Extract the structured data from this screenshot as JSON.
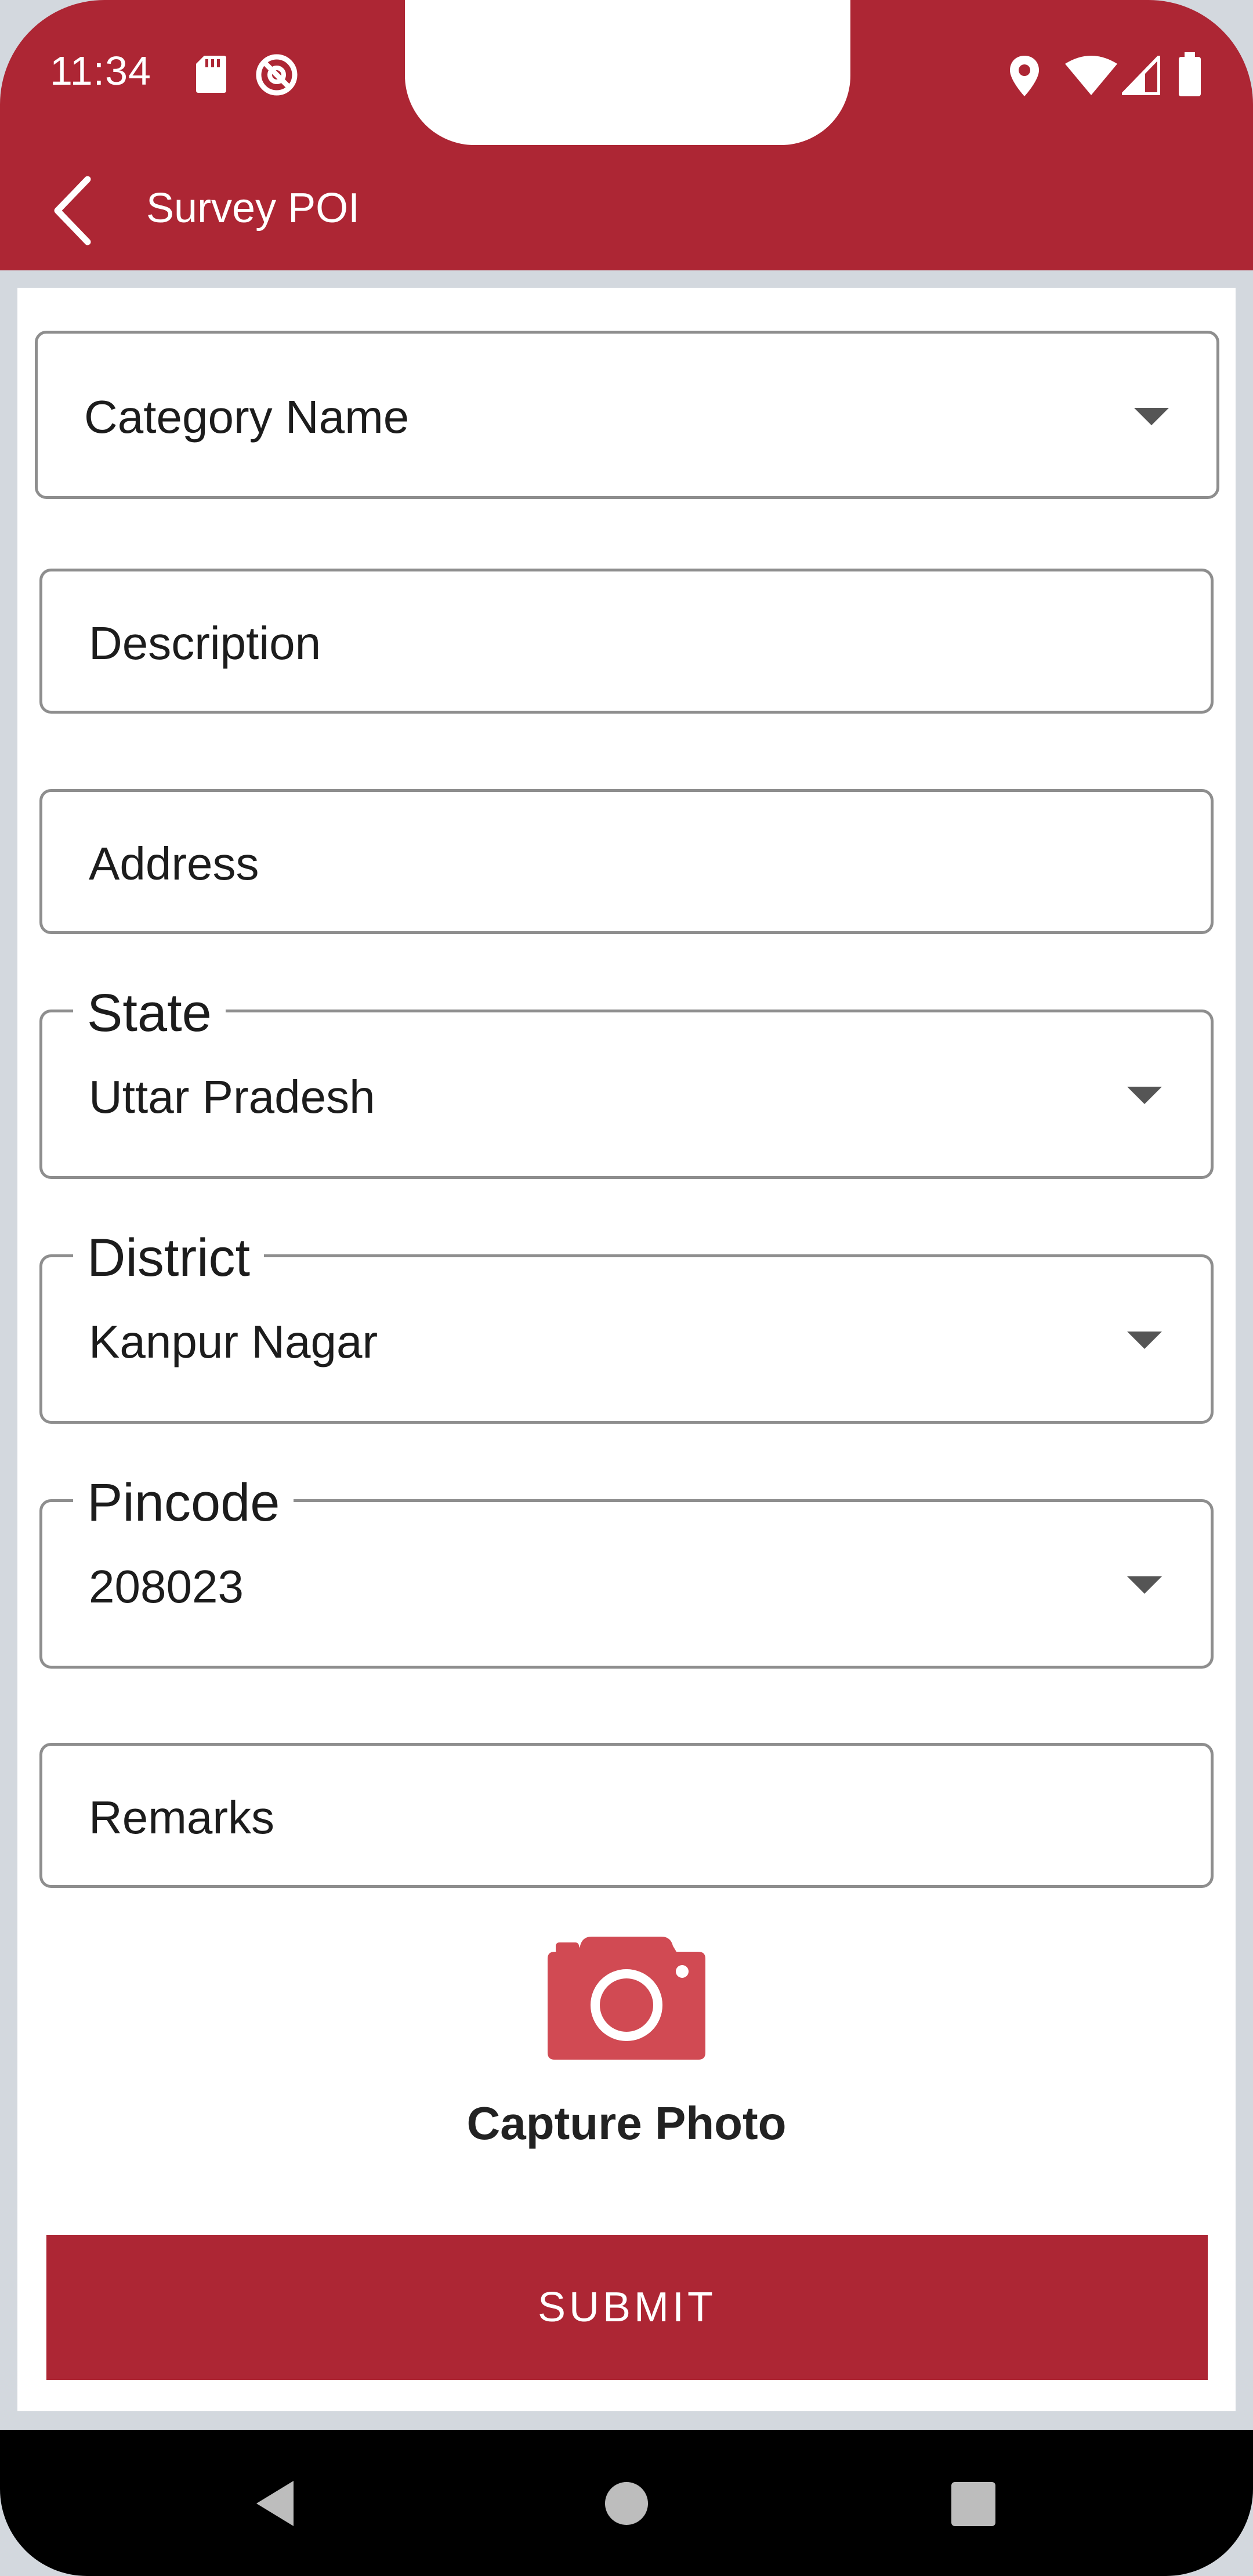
{
  "status_bar": {
    "time": "11:34",
    "left_icons": [
      "sd-card-icon",
      "do-not-disturb-icon"
    ],
    "right_icons": [
      "location-icon",
      "wifi-icon",
      "cell-signal-icon",
      "battery-icon"
    ]
  },
  "app_bar": {
    "title": "Survey POI",
    "back_icon": "chevron-left-icon"
  },
  "form": {
    "category": {
      "placeholder": "Category Name"
    },
    "description": {
      "placeholder": "Description"
    },
    "address": {
      "placeholder": "Address"
    },
    "state": {
      "label": "State",
      "value": "Uttar Pradesh"
    },
    "district": {
      "label": "District",
      "value": "Kanpur Nagar"
    },
    "pincode": {
      "label": "Pincode",
      "value": "208023"
    },
    "remarks": {
      "placeholder": "Remarks"
    },
    "capture_photo_label": "Capture Photo",
    "submit_label": "SUBMIT"
  },
  "nav_bar": {
    "icons": [
      "back-triangle-icon",
      "home-circle-icon",
      "recents-square-icon"
    ]
  },
  "colors": {
    "primary": "#ad2634",
    "camera_icon": "#d14a53",
    "background": "#d3d8de",
    "field_border": "#8e8e8e"
  }
}
